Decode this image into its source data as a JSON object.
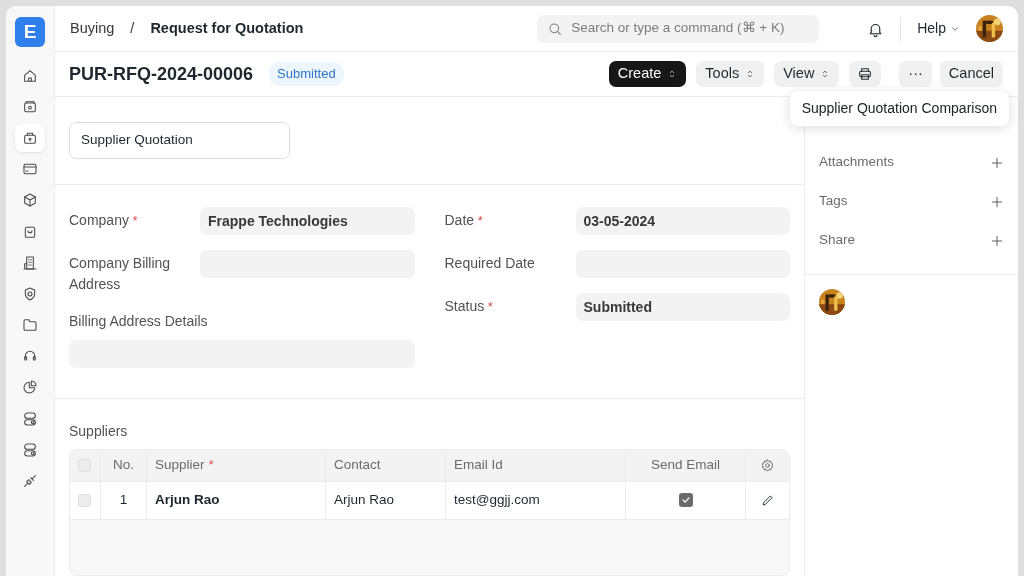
{
  "logo": "E",
  "breadcrumbs": [
    {
      "label": "Buying"
    },
    {
      "label": "Request for Quotation"
    }
  ],
  "breadcrumb_separator": "/",
  "search": {
    "placeholder": "Search or type a command (⌘ + K)"
  },
  "help": "Help",
  "sidebar": {
    "items": [
      {
        "selected": false
      },
      {
        "selected": false
      },
      {
        "selected": true
      },
      {
        "selected": false
      },
      {
        "selected": false
      },
      {
        "selected": false
      },
      {
        "selected": false
      },
      {
        "selected": false
      },
      {
        "selected": false
      },
      {
        "selected": false
      },
      {
        "selected": false
      },
      {
        "selected": false
      },
      {
        "selected": false
      },
      {
        "selected": false
      }
    ]
  },
  "document": {
    "title": "PUR-RFQ-2024-00006",
    "status": "Submitted"
  },
  "actions": [
    {
      "kind": "primary",
      "label": "Create"
    },
    {
      "kind": "menu",
      "label": "Tools"
    },
    {
      "kind": "menu",
      "label": "View"
    },
    {
      "kind": "print"
    },
    {
      "kind": "more",
      "label": "···"
    },
    {
      "kind": "plain",
      "label": "Cancel"
    }
  ],
  "dropdown": {
    "items": [
      "Supplier Quotation Comparison"
    ]
  },
  "supplier_quotation_button": "Supplier Quotation",
  "fields_left": [
    {
      "label": "Company",
      "required_mark": "*",
      "value": "Frappe Technologies",
      "kind": "side"
    },
    {
      "label": "Company Billing Address",
      "kind": "side"
    },
    {
      "label": "Billing Address Details",
      "kind": "stacked"
    }
  ],
  "fields_right": [
    {
      "label": "Date",
      "required_mark": "*",
      "value": "03-05-2024",
      "kind": "side"
    },
    {
      "label": "Required Date",
      "kind": "side"
    },
    {
      "label": "Status",
      "required_mark": "*",
      "value": "Submitted",
      "kind": "side"
    }
  ],
  "suppliers": {
    "label": "Suppliers",
    "select_all": false,
    "columns": [
      {
        "label": "No."
      },
      {
        "label": "Supplier",
        "required_mark": "*"
      },
      {
        "label": "Contact"
      },
      {
        "label": "Email Id"
      },
      {
        "label": "Send Email"
      }
    ],
    "rows": [
      {
        "no": "1",
        "supplier": "Arjun Rao",
        "contact": "Arjun Rao",
        "email": "test@ggjj.com",
        "send_email": true,
        "selected": false
      }
    ]
  },
  "side_panel": [
    {
      "label": "Attachments"
    },
    {
      "label": "Tags"
    },
    {
      "label": "Share"
    }
  ]
}
